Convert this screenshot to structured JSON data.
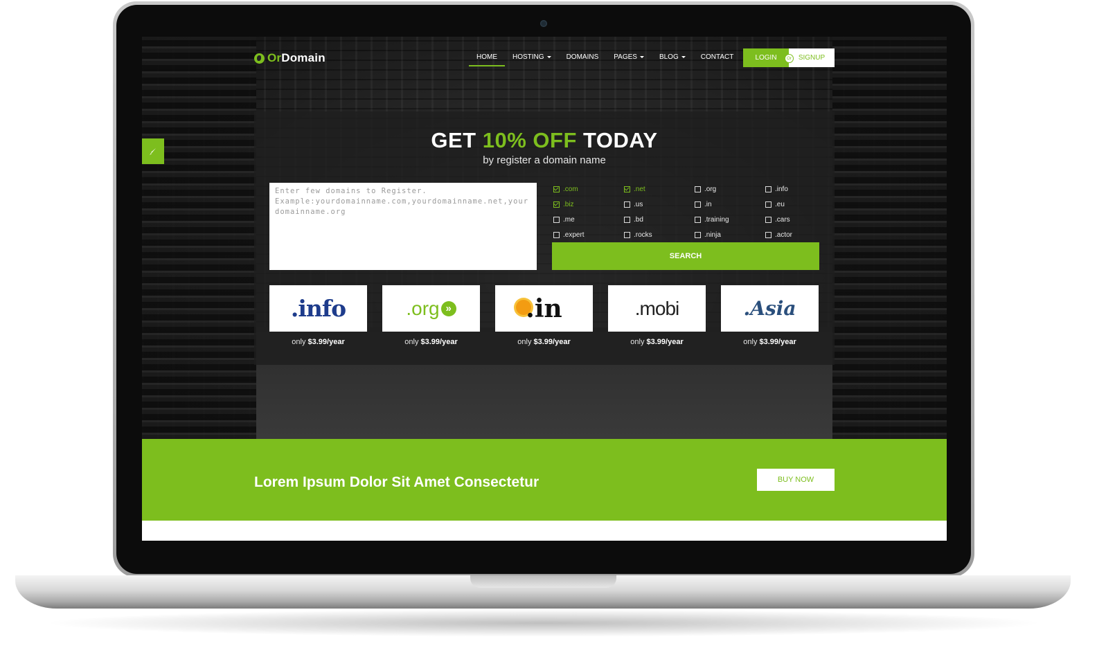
{
  "site": {
    "logo_prefix": "Or",
    "logo_suffix": "Domain"
  },
  "nav": {
    "items": [
      {
        "label": "HOME"
      },
      {
        "label": "HOSTING"
      },
      {
        "label": "DOMAINS"
      },
      {
        "label": "PAGES"
      },
      {
        "label": "BLOG"
      },
      {
        "label": "CONTACT"
      }
    ],
    "login_label": "LOGIN",
    "or_label": "Or",
    "signup_label": "SIGNUP"
  },
  "hero": {
    "headline_pre": "GET ",
    "headline_accent": "10% OFF",
    "headline_post": " TODAY",
    "subheadline": "by register a domain name",
    "domains_placeholder": "Enter few domains to Register. Example:yourdomainname.com,yourdomainname.net,yourdomainname.org",
    "tlds": [
      {
        "label": ".com",
        "checked": true
      },
      {
        "label": ".net",
        "checked": true
      },
      {
        "label": ".org",
        "checked": false
      },
      {
        "label": ".info",
        "checked": false
      },
      {
        "label": ".biz",
        "checked": true
      },
      {
        "label": ".us",
        "checked": false
      },
      {
        "label": ".in",
        "checked": false
      },
      {
        "label": ".eu",
        "checked": false
      },
      {
        "label": ".me",
        "checked": false
      },
      {
        "label": ".bd",
        "checked": false
      },
      {
        "label": ".training",
        "checked": false
      },
      {
        "label": ".cars",
        "checked": false
      },
      {
        "label": ".expert",
        "checked": false
      },
      {
        "label": ".rocks",
        "checked": false
      },
      {
        "label": ".ninja",
        "checked": false
      },
      {
        "label": ".actor",
        "checked": false
      }
    ],
    "search_label": "SEARCH",
    "cards": [
      {
        "logo": ".info",
        "price_prefix": "only ",
        "price": "$3.99/year"
      },
      {
        "logo": ".org",
        "price_prefix": "only ",
        "price": "$3.99/year"
      },
      {
        "logo": ".in",
        "price_prefix": "only ",
        "price": "$3.99/year"
      },
      {
        "logo": ".mobi",
        "price_prefix": "only ",
        "price": "$3.99/year"
      },
      {
        "logo": ".Asia",
        "price_prefix": "only ",
        "price": "$3.99/year"
      }
    ]
  },
  "cta": {
    "text": "Lorem Ipsum Dolor Sit Amet Consectetur",
    "button_label": "BUY NOW"
  },
  "colors": {
    "accent": "#7dbe1e",
    "panel": "#1e1e1e",
    "white": "#ffffff"
  }
}
